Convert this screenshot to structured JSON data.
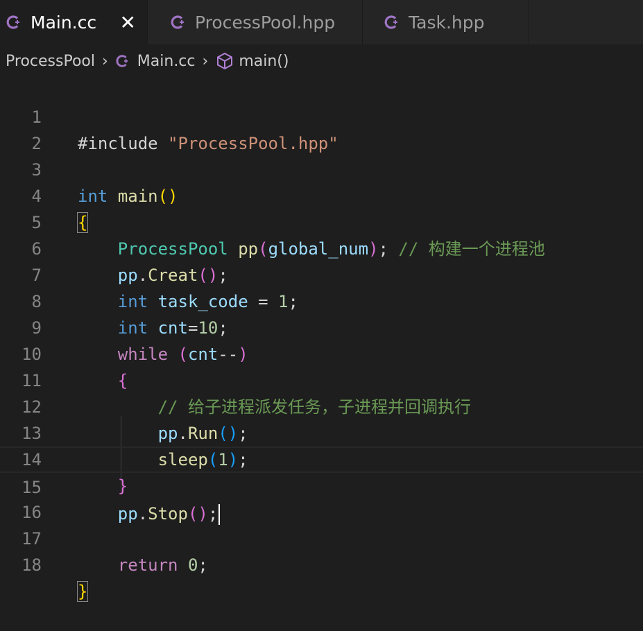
{
  "tabs": [
    {
      "label": "Main.cc",
      "active": true
    },
    {
      "label": "ProcessPool.hpp",
      "active": false
    },
    {
      "label": "Task.hpp",
      "active": false
    }
  ],
  "tab_close_glyph": "✕",
  "breadcrumb": {
    "folder": "ProcessPool",
    "file": "Main.cc",
    "symbol": "main()"
  },
  "line_numbers": [
    "1",
    "2",
    "3",
    "4",
    "5",
    "6",
    "7",
    "8",
    "9",
    "10",
    "11",
    "12",
    "13",
    "14",
    "15",
    "16",
    "17",
    "18"
  ],
  "code": {
    "l1_directive": "#include",
    "l1_path": "\"ProcessPool.hpp\"",
    "l3_type": "int",
    "l3_func": "main",
    "l5_class": "ProcessPool",
    "l5_obj": "pp",
    "l5_arg": "global_num",
    "l5_comment": "// 构建一个进程池",
    "l6_obj": "pp",
    "l6_method": "Creat",
    "l7_type": "int",
    "l7_var": "task_code",
    "l7_value": "1",
    "l8_type": "int",
    "l8_var": "cnt",
    "l8_value": "10",
    "l9_keyword": "while",
    "l9_var": "cnt",
    "l11_comment": "// 给子进程派发任务，子进程并回调执行",
    "l12_obj": "pp",
    "l12_method": "Run",
    "l13_func": "sleep",
    "l13_arg": "1",
    "l15_obj": "pp",
    "l15_method": "Stop",
    "l17_keyword": "return",
    "l17_value": "0"
  },
  "colors": {
    "editor_bg": "#1e1e1e",
    "keyword": "#569cd6",
    "control": "#c586c0",
    "string": "#ce9178",
    "function": "#dcdcaa",
    "type": "#4ec9b0",
    "variable": "#9cdcfe",
    "comment": "#6a9955",
    "number": "#b5cea8",
    "cpp_icon": "#a074c4"
  },
  "icons": {
    "file_icon": "cpp-file-icon",
    "symbol_icon": "cube-symbol-icon",
    "close_icon": "close-icon",
    "chevron": "chevron-right-icon"
  }
}
